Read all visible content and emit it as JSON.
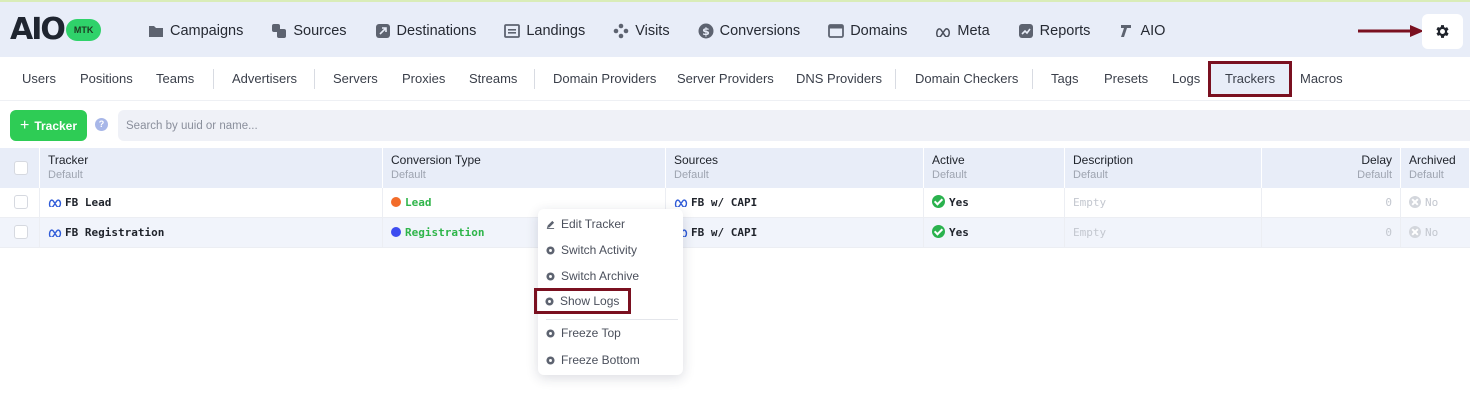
{
  "logo": {
    "text": "AIO",
    "badge": "MTK"
  },
  "nav": [
    {
      "label": "Campaigns",
      "icon": "folder-icon"
    },
    {
      "label": "Sources",
      "icon": "sources-icon"
    },
    {
      "label": "Destinations",
      "icon": "destinations-icon"
    },
    {
      "label": "Landings",
      "icon": "landings-icon"
    },
    {
      "label": "Visits",
      "icon": "visits-icon"
    },
    {
      "label": "Conversions",
      "icon": "dollar-icon"
    },
    {
      "label": "Domains",
      "icon": "domains-icon"
    },
    {
      "label": "Meta",
      "icon": "meta-icon"
    },
    {
      "label": "Reports",
      "icon": "reports-icon"
    },
    {
      "label": "AIO",
      "icon": "aio-icon"
    }
  ],
  "subnav": [
    "Users",
    "Positions",
    "Teams",
    "Advertisers",
    "Servers",
    "Proxies",
    "Streams",
    "Domain Providers",
    "Server Providers",
    "DNS Providers",
    "Domain Checkers",
    "Tags",
    "Presets",
    "Logs",
    "Trackers",
    "Macros"
  ],
  "subnav_active": "Trackers",
  "toolbar": {
    "add_label": "Tracker",
    "help": "?",
    "search_placeholder": "Search by uuid or name..."
  },
  "table": {
    "columns": [
      {
        "title": "Tracker",
        "sub": "Default"
      },
      {
        "title": "Conversion Type",
        "sub": "Default"
      },
      {
        "title": "Sources",
        "sub": "Default"
      },
      {
        "title": "Active",
        "sub": "Default"
      },
      {
        "title": "Description",
        "sub": "Default"
      },
      {
        "title": "Delay",
        "sub": "Default"
      },
      {
        "title": "Archived",
        "sub": "Default"
      }
    ],
    "rows": [
      {
        "tracker": "FB Lead",
        "conversion_type": "Lead",
        "conversion_color": "#f26c2a",
        "source": "FB w/ CAPI",
        "active": "Yes",
        "description": "Empty",
        "delay": "0",
        "archived": "No"
      },
      {
        "tracker": "FB Registration",
        "conversion_type": "Registration",
        "conversion_color": "#3d4cf0",
        "source": "FB w/ CAPI",
        "active": "Yes",
        "description": "Empty",
        "delay": "0",
        "archived": "No"
      }
    ]
  },
  "context_menu": {
    "items": [
      "Edit Tracker",
      "Switch Activity",
      "Switch Archive",
      "Show Logs",
      "Freeze Top",
      "Freeze Bottom"
    ]
  },
  "colors": {
    "accent_green": "#2ecc55",
    "highlight": "#7a1020",
    "nav_bg": "#e8edf8"
  }
}
